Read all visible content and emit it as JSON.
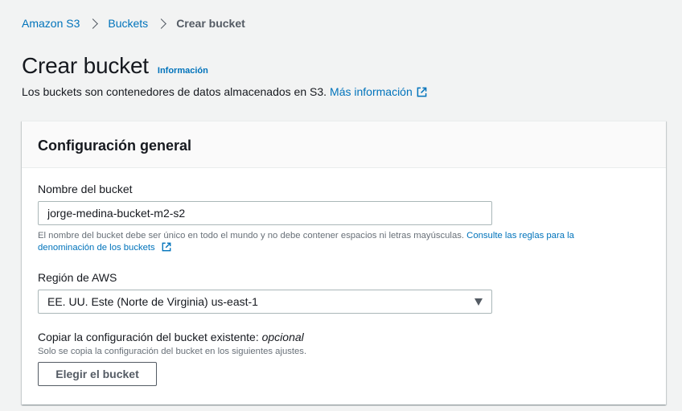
{
  "breadcrumb": {
    "items": [
      "Amazon S3",
      "Buckets"
    ],
    "current": "Crear bucket"
  },
  "header": {
    "title": "Crear bucket",
    "info_link": "Información",
    "description": "Los buckets son contenedores de datos almacenados en S3.",
    "more_info_link": "Más información"
  },
  "panel": {
    "title": "Configuración general",
    "bucket_name": {
      "label": "Nombre del bucket",
      "value": "jorge-medina-bucket-m2-s2",
      "hint": "El nombre del bucket debe ser único en todo el mundo y no debe contener espacios ni letras mayúsculas.",
      "hint_link": "Consulte las reglas para la denominación de los buckets"
    },
    "region": {
      "label": "Región de AWS",
      "selected": "EE. UU. Este (Norte de Virginia) us-east-1"
    },
    "copy_settings": {
      "label": "Copiar la configuración del bucket existente:",
      "label_optional": "opcional",
      "description": "Solo se copia la configuración del bucket en los siguientes ajustes.",
      "button": "Elegir el bucket"
    }
  },
  "colors": {
    "link": "#0073bb",
    "background": "#f2f3f3",
    "text": "#16191f",
    "secondary_text": "#687078"
  },
  "icons": {
    "breadcrumb_separator": "chevron-right-icon",
    "external_link": "external-link-icon",
    "select_caret": "caret-down-icon"
  }
}
